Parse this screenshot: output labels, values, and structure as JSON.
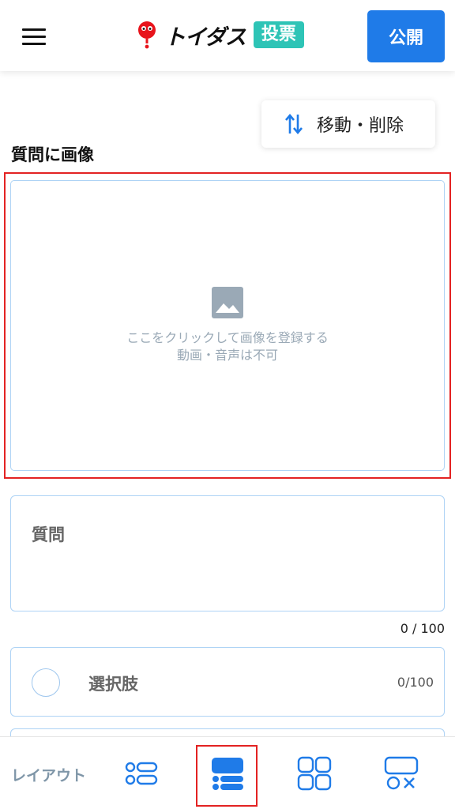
{
  "header": {
    "logo_text": "トイダス",
    "logo_badge": "投票",
    "publish_label": "公開"
  },
  "toolbar": {
    "move_delete_label": "移動・削除"
  },
  "image_section": {
    "title": "質問に画像",
    "hint_line1": "ここをクリックして画像を登録する",
    "hint_line2": "動画・音声は不可"
  },
  "question": {
    "placeholder": "質問",
    "counter": "0 / 100"
  },
  "choice": {
    "placeholder": "選択肢",
    "counter": "0/100"
  },
  "bottom_bar": {
    "layout_label": "レイアウト",
    "selected_option_index": 2
  },
  "colors": {
    "accent": "#1f7be8",
    "badge": "#2ec4b6",
    "highlight": "#e32222",
    "field_border": "#aed3f5"
  }
}
